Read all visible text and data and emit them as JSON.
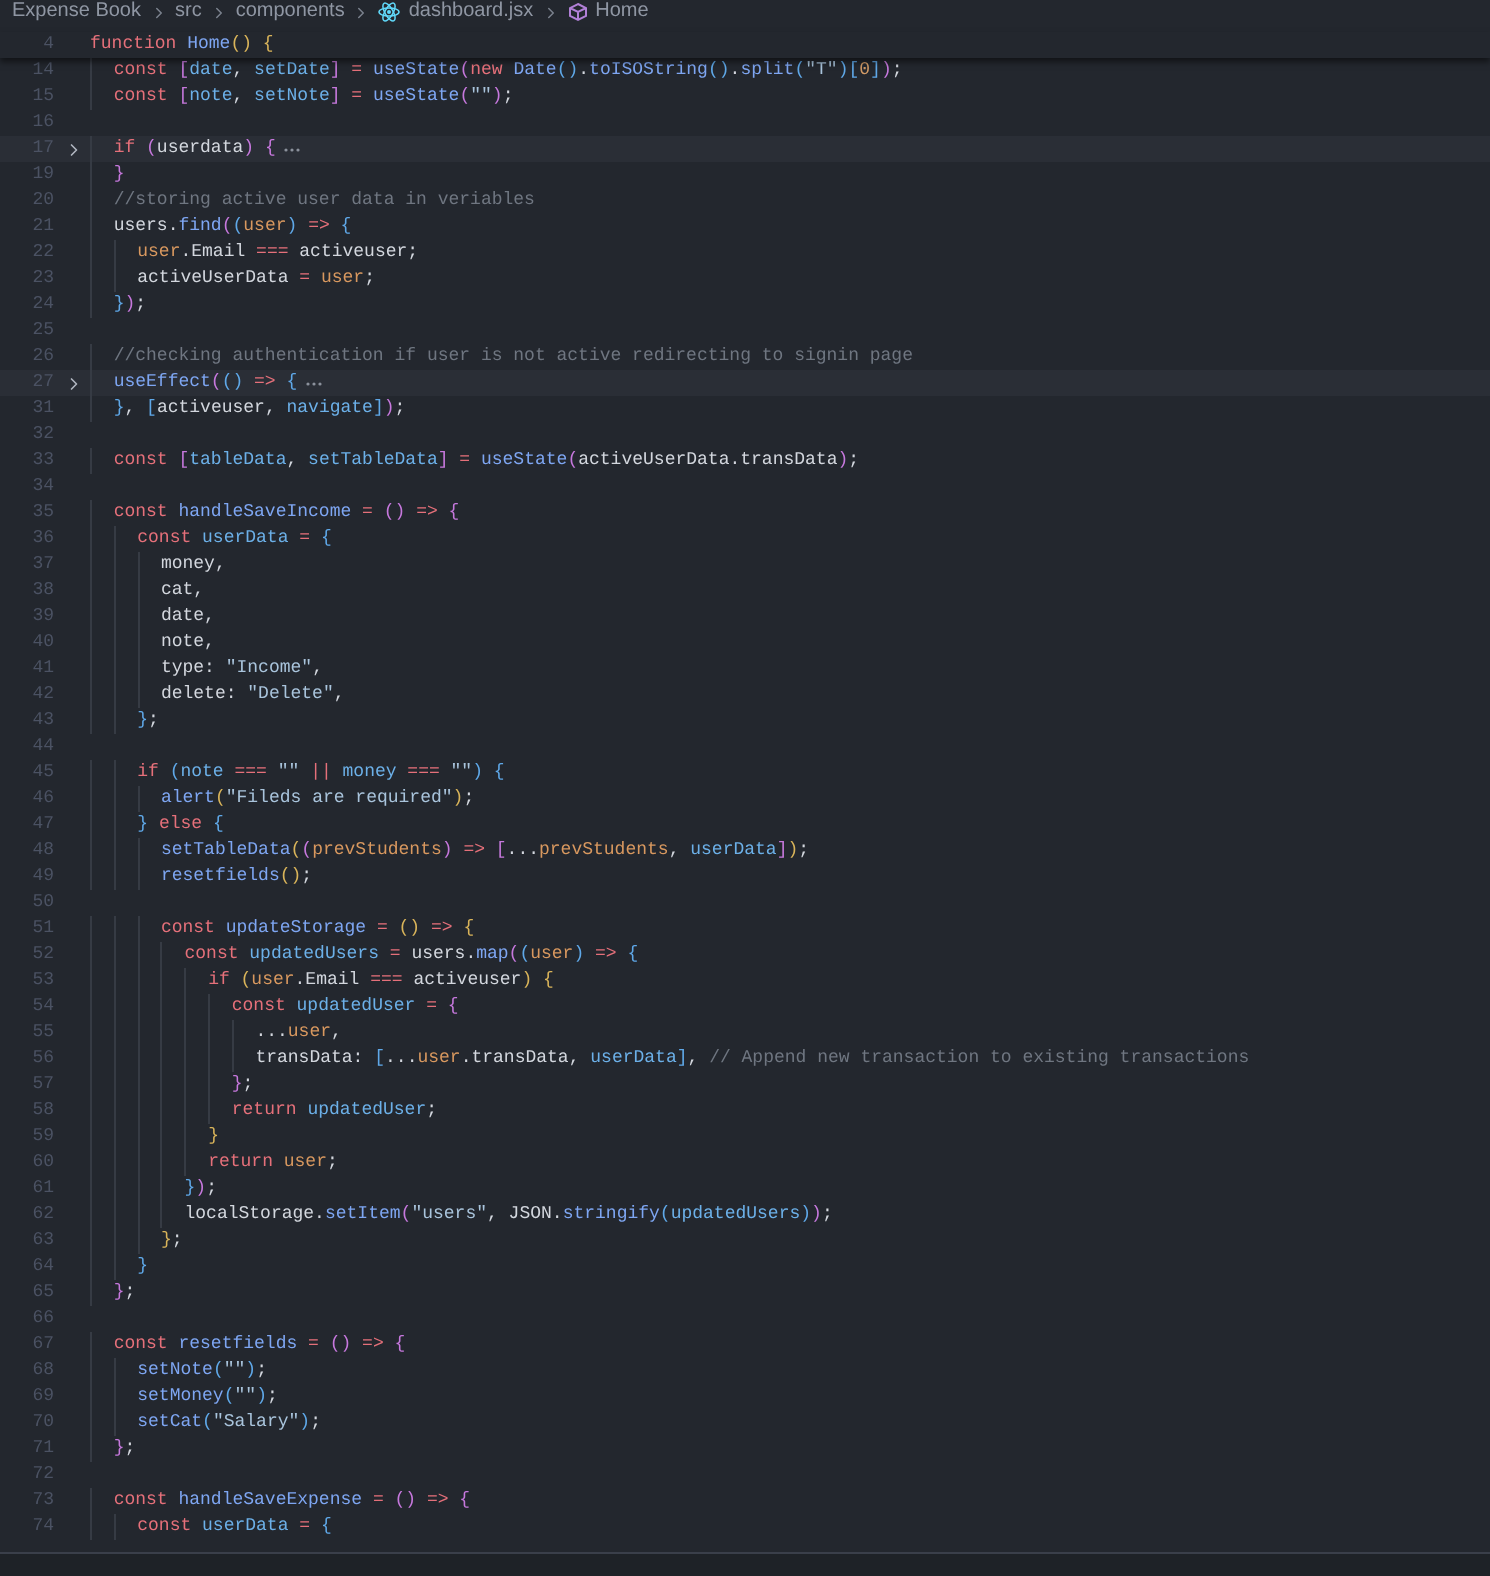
{
  "breadcrumb": [
    {
      "text": "Expense Book",
      "kind": "folder"
    },
    {
      "text": "src",
      "kind": "folder"
    },
    {
      "text": "components",
      "kind": "folder"
    },
    {
      "text": "dashboard.jsx",
      "kind": "file"
    },
    {
      "text": "Home",
      "kind": "symbol"
    }
  ],
  "sticky_line": {
    "number": "4",
    "folded": false,
    "tokens": [
      {
        "text": "function ",
        "kind": "keyword"
      },
      {
        "text": "Home",
        "kind": "function"
      },
      {
        "text": "() ",
        "kind": "bracket1"
      },
      {
        "text": "{",
        "kind": "bracket1"
      }
    ]
  },
  "lines": [
    {
      "number": "14",
      "folded": false,
      "tokens": [
        {
          "text": "  const ",
          "kind": "keyword"
        },
        {
          "text": "[",
          "kind": "bracket2"
        },
        {
          "text": "date",
          "kind": "variable"
        },
        {
          "text": ", ",
          "kind": "plain"
        },
        {
          "text": "setDate",
          "kind": "variable"
        },
        {
          "text": "] ",
          "kind": "bracket2"
        },
        {
          "text": "= ",
          "kind": "operator"
        },
        {
          "text": "useState",
          "kind": "function"
        },
        {
          "text": "(",
          "kind": "bracket2"
        },
        {
          "text": "new ",
          "kind": "keyword"
        },
        {
          "text": "Date",
          "kind": "function"
        },
        {
          "text": "()",
          "kind": "bracket3"
        },
        {
          "text": ".",
          "kind": "plain"
        },
        {
          "text": "toISOString",
          "kind": "function"
        },
        {
          "text": "()",
          "kind": "bracket3"
        },
        {
          "text": ".",
          "kind": "plain"
        },
        {
          "text": "split",
          "kind": "function"
        },
        {
          "text": "(",
          "kind": "bracket3"
        },
        {
          "text": "\"T\"",
          "kind": "string"
        },
        {
          "text": ")",
          "kind": "bracket3"
        },
        {
          "text": "[",
          "kind": "bracket3"
        },
        {
          "text": "0",
          "kind": "number"
        },
        {
          "text": "]",
          "kind": "bracket3"
        },
        {
          "text": ")",
          "kind": "bracket2"
        },
        {
          "text": ";",
          "kind": "plain"
        }
      ]
    },
    {
      "number": "15",
      "folded": false,
      "tokens": [
        {
          "text": "  const ",
          "kind": "keyword"
        },
        {
          "text": "[",
          "kind": "bracket2"
        },
        {
          "text": "note",
          "kind": "variable"
        },
        {
          "text": ", ",
          "kind": "plain"
        },
        {
          "text": "setNote",
          "kind": "variable"
        },
        {
          "text": "] ",
          "kind": "bracket2"
        },
        {
          "text": "= ",
          "kind": "operator"
        },
        {
          "text": "useState",
          "kind": "function"
        },
        {
          "text": "(",
          "kind": "bracket2"
        },
        {
          "text": "\"\"",
          "kind": "string"
        },
        {
          "text": ")",
          "kind": "bracket2"
        },
        {
          "text": ";",
          "kind": "plain"
        }
      ]
    },
    {
      "number": "16",
      "folded": false
    },
    {
      "number": "17",
      "folded": true,
      "tokens": [
        {
          "text": "  if ",
          "kind": "keyword"
        },
        {
          "text": "(",
          "kind": "bracket2"
        },
        {
          "text": "userdata",
          "kind": "plain"
        },
        {
          "text": ") ",
          "kind": "bracket2"
        },
        {
          "text": "{",
          "kind": "bracket2"
        }
      ]
    },
    {
      "number": "19",
      "folded": false,
      "tokens": [
        {
          "text": "  }",
          "kind": "bracket2"
        }
      ]
    },
    {
      "number": "20",
      "folded": false,
      "tokens": [
        {
          "text": "  //storing active user data in veriables",
          "kind": "comment"
        }
      ]
    },
    {
      "number": "21",
      "folded": false,
      "tokens": [
        {
          "text": "  users.",
          "kind": "plain"
        },
        {
          "text": "find",
          "kind": "function"
        },
        {
          "text": "(",
          "kind": "bracket2"
        },
        {
          "text": "(",
          "kind": "bracket3"
        },
        {
          "text": "user",
          "kind": "parameter"
        },
        {
          "text": ") ",
          "kind": "bracket3"
        },
        {
          "text": "=> ",
          "kind": "operator"
        },
        {
          "text": "{",
          "kind": "bracket3"
        }
      ]
    },
    {
      "number": "22",
      "folded": false,
      "tokens": [
        {
          "text": "    user",
          "kind": "parameter"
        },
        {
          "text": ".Email ",
          "kind": "plain"
        },
        {
          "text": "===",
          "kind": "operator"
        },
        {
          "text": " activeuser;",
          "kind": "plain"
        }
      ]
    },
    {
      "number": "23",
      "folded": false,
      "tokens": [
        {
          "text": "    activeUserData ",
          "kind": "plain"
        },
        {
          "text": "= ",
          "kind": "operator"
        },
        {
          "text": "user",
          "kind": "parameter"
        },
        {
          "text": ";",
          "kind": "plain"
        }
      ]
    },
    {
      "number": "24",
      "folded": false,
      "tokens": [
        {
          "text": "  }",
          "kind": "bracket3"
        },
        {
          "text": ")",
          "kind": "bracket2"
        },
        {
          "text": ";",
          "kind": "plain"
        }
      ]
    },
    {
      "number": "25",
      "folded": false
    },
    {
      "number": "26",
      "folded": false,
      "tokens": [
        {
          "text": "  //checking authentication if user is not active redirecting to signin page",
          "kind": "comment"
        }
      ]
    },
    {
      "number": "27",
      "folded": true,
      "tokens": [
        {
          "text": "  useEffect",
          "kind": "function"
        },
        {
          "text": "(",
          "kind": "bracket2"
        },
        {
          "text": "() ",
          "kind": "bracket3"
        },
        {
          "text": "=> ",
          "kind": "operator"
        },
        {
          "text": "{",
          "kind": "bracket3"
        }
      ]
    },
    {
      "number": "31",
      "folded": false,
      "tokens": [
        {
          "text": "  }",
          "kind": "bracket3"
        },
        {
          "text": ", ",
          "kind": "plain"
        },
        {
          "text": "[",
          "kind": "bracket3"
        },
        {
          "text": "activeuser, ",
          "kind": "plain"
        },
        {
          "text": "navigate",
          "kind": "variable"
        },
        {
          "text": "]",
          "kind": "bracket3"
        },
        {
          "text": ")",
          "kind": "bracket2"
        },
        {
          "text": ";",
          "kind": "plain"
        }
      ]
    },
    {
      "number": "32",
      "folded": false
    },
    {
      "number": "33",
      "folded": false,
      "tokens": [
        {
          "text": "  const ",
          "kind": "keyword"
        },
        {
          "text": "[",
          "kind": "bracket2"
        },
        {
          "text": "tableData",
          "kind": "variable"
        },
        {
          "text": ", ",
          "kind": "plain"
        },
        {
          "text": "setTableData",
          "kind": "variable"
        },
        {
          "text": "] ",
          "kind": "bracket2"
        },
        {
          "text": "= ",
          "kind": "operator"
        },
        {
          "text": "useState",
          "kind": "function"
        },
        {
          "text": "(",
          "kind": "bracket2"
        },
        {
          "text": "activeUserData.transData",
          "kind": "plain"
        },
        {
          "text": ")",
          "kind": "bracket2"
        },
        {
          "text": ";",
          "kind": "plain"
        }
      ]
    },
    {
      "number": "34",
      "folded": false
    },
    {
      "number": "35",
      "folded": false,
      "tokens": [
        {
          "text": "  const ",
          "kind": "keyword"
        },
        {
          "text": "handleSaveIncome ",
          "kind": "function"
        },
        {
          "text": "= ",
          "kind": "operator"
        },
        {
          "text": "() ",
          "kind": "bracket2"
        },
        {
          "text": "=> ",
          "kind": "operator"
        },
        {
          "text": "{",
          "kind": "bracket2"
        }
      ]
    },
    {
      "number": "36",
      "folded": false,
      "tokens": [
        {
          "text": "    const ",
          "kind": "keyword"
        },
        {
          "text": "userData ",
          "kind": "variable"
        },
        {
          "text": "= ",
          "kind": "operator"
        },
        {
          "text": "{",
          "kind": "bracket3"
        }
      ]
    },
    {
      "number": "37",
      "folded": false,
      "tokens": [
        {
          "text": "      money,",
          "kind": "plain"
        }
      ]
    },
    {
      "number": "38",
      "folded": false,
      "tokens": [
        {
          "text": "      cat,",
          "kind": "plain"
        }
      ]
    },
    {
      "number": "39",
      "folded": false,
      "tokens": [
        {
          "text": "      date,",
          "kind": "plain"
        }
      ]
    },
    {
      "number": "40",
      "folded": false,
      "tokens": [
        {
          "text": "      note,",
          "kind": "plain"
        }
      ]
    },
    {
      "number": "41",
      "folded": false,
      "tokens": [
        {
          "text": "      type: ",
          "kind": "plain"
        },
        {
          "text": "\"Income\"",
          "kind": "string"
        },
        {
          "text": ",",
          "kind": "plain"
        }
      ]
    },
    {
      "number": "42",
      "folded": false,
      "tokens": [
        {
          "text": "      delete: ",
          "kind": "plain"
        },
        {
          "text": "\"Delete\"",
          "kind": "string"
        },
        {
          "text": ",",
          "kind": "plain"
        }
      ]
    },
    {
      "number": "43",
      "folded": false,
      "tokens": [
        {
          "text": "    }",
          "kind": "bracket3"
        },
        {
          "text": ";",
          "kind": "plain"
        }
      ]
    },
    {
      "number": "44",
      "folded": false
    },
    {
      "number": "45",
      "folded": false,
      "tokens": [
        {
          "text": "    if ",
          "kind": "keyword"
        },
        {
          "text": "(",
          "kind": "bracket3"
        },
        {
          "text": "note ",
          "kind": "variable"
        },
        {
          "text": "=== ",
          "kind": "operator"
        },
        {
          "text": "\"\" ",
          "kind": "string"
        },
        {
          "text": "|| ",
          "kind": "operator"
        },
        {
          "text": "money ",
          "kind": "variable"
        },
        {
          "text": "=== ",
          "kind": "operator"
        },
        {
          "text": "\"\"",
          "kind": "string"
        },
        {
          "text": ") ",
          "kind": "bracket3"
        },
        {
          "text": "{",
          "kind": "bracket3"
        }
      ]
    },
    {
      "number": "46",
      "folded": false,
      "tokens": [
        {
          "text": "      alert",
          "kind": "function"
        },
        {
          "text": "(",
          "kind": "bracket1"
        },
        {
          "text": "\"Fileds are required\"",
          "kind": "string"
        },
        {
          "text": ")",
          "kind": "bracket1"
        },
        {
          "text": ";",
          "kind": "plain"
        }
      ]
    },
    {
      "number": "47",
      "folded": false,
      "tokens": [
        {
          "text": "    } ",
          "kind": "bracket3"
        },
        {
          "text": "else ",
          "kind": "keyword"
        },
        {
          "text": "{",
          "kind": "bracket3"
        }
      ]
    },
    {
      "number": "48",
      "folded": false,
      "tokens": [
        {
          "text": "      setTableData",
          "kind": "function"
        },
        {
          "text": "(",
          "kind": "bracket1"
        },
        {
          "text": "(",
          "kind": "bracket2"
        },
        {
          "text": "prevStudents",
          "kind": "parameter"
        },
        {
          "text": ") ",
          "kind": "bracket2"
        },
        {
          "text": "=> ",
          "kind": "operator"
        },
        {
          "text": "[",
          "kind": "bracket2"
        },
        {
          "text": "...",
          "kind": "plain"
        },
        {
          "text": "prevStudents",
          "kind": "parameter"
        },
        {
          "text": ", ",
          "kind": "plain"
        },
        {
          "text": "userData",
          "kind": "variable"
        },
        {
          "text": "]",
          "kind": "bracket2"
        },
        {
          "text": ")",
          "kind": "bracket1"
        },
        {
          "text": ";",
          "kind": "plain"
        }
      ]
    },
    {
      "number": "49",
      "folded": false,
      "tokens": [
        {
          "text": "      resetfields",
          "kind": "function"
        },
        {
          "text": "()",
          "kind": "bracket1"
        },
        {
          "text": ";",
          "kind": "plain"
        }
      ]
    },
    {
      "number": "50",
      "folded": false
    },
    {
      "number": "51",
      "folded": false,
      "tokens": [
        {
          "text": "      const ",
          "kind": "keyword"
        },
        {
          "text": "updateStorage ",
          "kind": "function"
        },
        {
          "text": "= ",
          "kind": "operator"
        },
        {
          "text": "() ",
          "kind": "bracket1"
        },
        {
          "text": "=> ",
          "kind": "operator"
        },
        {
          "text": "{",
          "kind": "bracket1"
        }
      ]
    },
    {
      "number": "52",
      "folded": false,
      "tokens": [
        {
          "text": "        const ",
          "kind": "keyword"
        },
        {
          "text": "updatedUsers ",
          "kind": "variable"
        },
        {
          "text": "= ",
          "kind": "operator"
        },
        {
          "text": "users.",
          "kind": "plain"
        },
        {
          "text": "map",
          "kind": "function"
        },
        {
          "text": "(",
          "kind": "bracket2"
        },
        {
          "text": "(",
          "kind": "bracket3"
        },
        {
          "text": "user",
          "kind": "parameter"
        },
        {
          "text": ") ",
          "kind": "bracket3"
        },
        {
          "text": "=> ",
          "kind": "operator"
        },
        {
          "text": "{",
          "kind": "bracket3"
        }
      ]
    },
    {
      "number": "53",
      "folded": false,
      "tokens": [
        {
          "text": "          if ",
          "kind": "keyword"
        },
        {
          "text": "(",
          "kind": "bracket1"
        },
        {
          "text": "user",
          "kind": "parameter"
        },
        {
          "text": ".Email ",
          "kind": "plain"
        },
        {
          "text": "===",
          "kind": "operator"
        },
        {
          "text": " activeuser",
          "kind": "plain"
        },
        {
          "text": ") ",
          "kind": "bracket1"
        },
        {
          "text": "{",
          "kind": "bracket1"
        }
      ]
    },
    {
      "number": "54",
      "folded": false,
      "tokens": [
        {
          "text": "            const ",
          "kind": "keyword"
        },
        {
          "text": "updatedUser ",
          "kind": "variable"
        },
        {
          "text": "= ",
          "kind": "operator"
        },
        {
          "text": "{",
          "kind": "bracket2"
        }
      ]
    },
    {
      "number": "55",
      "folded": false,
      "tokens": [
        {
          "text": "              ...",
          "kind": "plain"
        },
        {
          "text": "user",
          "kind": "parameter"
        },
        {
          "text": ",",
          "kind": "plain"
        }
      ]
    },
    {
      "number": "56",
      "folded": false,
      "tokens": [
        {
          "text": "              transData: ",
          "kind": "plain"
        },
        {
          "text": "[",
          "kind": "bracket3"
        },
        {
          "text": "...",
          "kind": "plain"
        },
        {
          "text": "user",
          "kind": "parameter"
        },
        {
          "text": ".transData, ",
          "kind": "plain"
        },
        {
          "text": "userData",
          "kind": "variable"
        },
        {
          "text": "]",
          "kind": "bracket3"
        },
        {
          "text": ", ",
          "kind": "plain"
        },
        {
          "text": "// Append new transaction to existing transactions",
          "kind": "comment"
        }
      ]
    },
    {
      "number": "57",
      "folded": false,
      "tokens": [
        {
          "text": "            }",
          "kind": "bracket2"
        },
        {
          "text": ";",
          "kind": "plain"
        }
      ]
    },
    {
      "number": "58",
      "folded": false,
      "tokens": [
        {
          "text": "            return ",
          "kind": "keyword"
        },
        {
          "text": "updatedUser",
          "kind": "variable"
        },
        {
          "text": ";",
          "kind": "plain"
        }
      ]
    },
    {
      "number": "59",
      "folded": false,
      "tokens": [
        {
          "text": "          }",
          "kind": "bracket1"
        }
      ]
    },
    {
      "number": "60",
      "folded": false,
      "tokens": [
        {
          "text": "          return ",
          "kind": "keyword"
        },
        {
          "text": "user",
          "kind": "parameter"
        },
        {
          "text": ";",
          "kind": "plain"
        }
      ]
    },
    {
      "number": "61",
      "folded": false,
      "tokens": [
        {
          "text": "        }",
          "kind": "bracket3"
        },
        {
          "text": ")",
          "kind": "bracket2"
        },
        {
          "text": ";",
          "kind": "plain"
        }
      ]
    },
    {
      "number": "62",
      "folded": false,
      "tokens": [
        {
          "text": "        localStorage.",
          "kind": "plain"
        },
        {
          "text": "setItem",
          "kind": "function"
        },
        {
          "text": "(",
          "kind": "bracket2"
        },
        {
          "text": "\"users\"",
          "kind": "string"
        },
        {
          "text": ", JSON.",
          "kind": "plain"
        },
        {
          "text": "stringify",
          "kind": "function"
        },
        {
          "text": "(",
          "kind": "bracket3"
        },
        {
          "text": "updatedUsers",
          "kind": "variable"
        },
        {
          "text": ")",
          "kind": "bracket3"
        },
        {
          "text": ")",
          "kind": "bracket2"
        },
        {
          "text": ";",
          "kind": "plain"
        }
      ]
    },
    {
      "number": "63",
      "folded": false,
      "tokens": [
        {
          "text": "      }",
          "kind": "bracket1"
        },
        {
          "text": ";",
          "kind": "plain"
        }
      ]
    },
    {
      "number": "64",
      "folded": false,
      "tokens": [
        {
          "text": "    }",
          "kind": "bracket3"
        }
      ]
    },
    {
      "number": "65",
      "folded": false,
      "tokens": [
        {
          "text": "  }",
          "kind": "bracket2"
        },
        {
          "text": ";",
          "kind": "plain"
        }
      ]
    },
    {
      "number": "66",
      "folded": false
    },
    {
      "number": "67",
      "folded": false,
      "tokens": [
        {
          "text": "  const ",
          "kind": "keyword"
        },
        {
          "text": "resetfields ",
          "kind": "function"
        },
        {
          "text": "= ",
          "kind": "operator"
        },
        {
          "text": "() ",
          "kind": "bracket2"
        },
        {
          "text": "=> ",
          "kind": "operator"
        },
        {
          "text": "{",
          "kind": "bracket2"
        }
      ]
    },
    {
      "number": "68",
      "folded": false,
      "tokens": [
        {
          "text": "    setNote",
          "kind": "function"
        },
        {
          "text": "(",
          "kind": "bracket3"
        },
        {
          "text": "\"\"",
          "kind": "string"
        },
        {
          "text": ")",
          "kind": "bracket3"
        },
        {
          "text": ";",
          "kind": "plain"
        }
      ]
    },
    {
      "number": "69",
      "folded": false,
      "tokens": [
        {
          "text": "    setMoney",
          "kind": "function"
        },
        {
          "text": "(",
          "kind": "bracket3"
        },
        {
          "text": "\"\"",
          "kind": "string"
        },
        {
          "text": ")",
          "kind": "bracket3"
        },
        {
          "text": ";",
          "kind": "plain"
        }
      ]
    },
    {
      "number": "70",
      "folded": false,
      "tokens": [
        {
          "text": "    setCat",
          "kind": "function"
        },
        {
          "text": "(",
          "kind": "bracket3"
        },
        {
          "text": "\"Salary\"",
          "kind": "string"
        },
        {
          "text": ")",
          "kind": "bracket3"
        },
        {
          "text": ";",
          "kind": "plain"
        }
      ]
    },
    {
      "number": "71",
      "folded": false,
      "tokens": [
        {
          "text": "  }",
          "kind": "bracket2"
        },
        {
          "text": ";",
          "kind": "plain"
        }
      ]
    },
    {
      "number": "72",
      "folded": false
    },
    {
      "number": "73",
      "folded": false,
      "tokens": [
        {
          "text": "  const ",
          "kind": "keyword"
        },
        {
          "text": "handleSaveExpense ",
          "kind": "function"
        },
        {
          "text": "= ",
          "kind": "operator"
        },
        {
          "text": "() ",
          "kind": "bracket2"
        },
        {
          "text": "=> ",
          "kind": "operator"
        },
        {
          "text": "{",
          "kind": "bracket2"
        }
      ]
    },
    {
      "number": "74",
      "folded": false,
      "tokens": [
        {
          "text": "    const ",
          "kind": "keyword"
        },
        {
          "text": "userData ",
          "kind": "variable"
        },
        {
          "text": "= ",
          "kind": "operator"
        },
        {
          "text": "{",
          "kind": "bracket3"
        }
      ]
    }
  ]
}
